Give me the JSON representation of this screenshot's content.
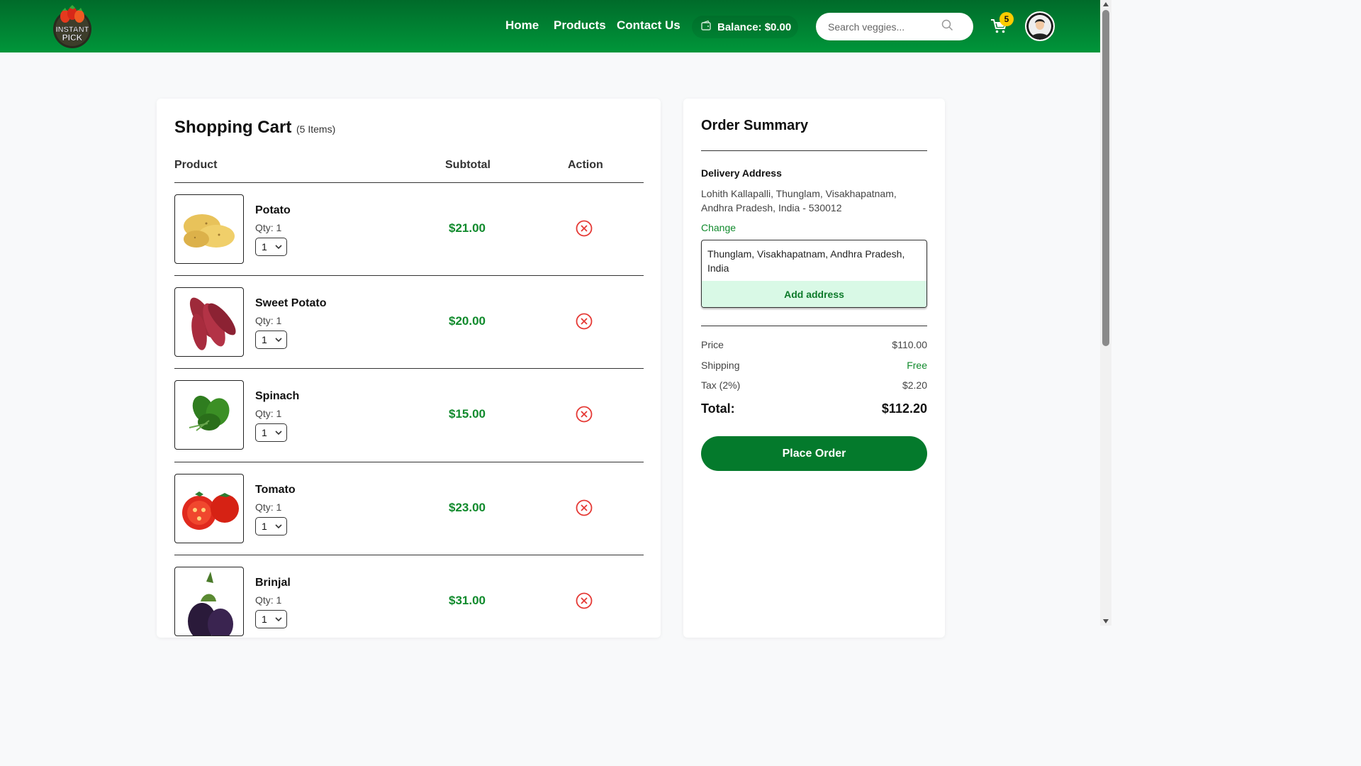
{
  "header": {
    "logo_text_line1": "INSTANT",
    "logo_text_line2": "PICK",
    "nav": {
      "home": "Home",
      "products": "Products",
      "contact": "Contact Us"
    },
    "balance_label": "Balance: $0.00",
    "search_placeholder": "Search veggies...",
    "cart_badge": "5"
  },
  "cart": {
    "title": "Shopping Cart",
    "count": "(5 Items)",
    "columns": {
      "product": "Product",
      "subtotal": "Subtotal",
      "action": "Action"
    },
    "items": [
      {
        "name": "Potato",
        "qty_label": "Qty: 1",
        "qty_value": "1",
        "subtotal": "$21.00",
        "icon": "potato-image"
      },
      {
        "name": "Sweet Potato",
        "qty_label": "Qty: 1",
        "qty_value": "1",
        "subtotal": "$20.00",
        "icon": "sweet-potato-image"
      },
      {
        "name": "Spinach",
        "qty_label": "Qty: 1",
        "qty_value": "1",
        "subtotal": "$15.00",
        "icon": "spinach-image"
      },
      {
        "name": "Tomato",
        "qty_label": "Qty: 1",
        "qty_value": "1",
        "subtotal": "$23.00",
        "icon": "tomato-image"
      },
      {
        "name": "Brinjal",
        "qty_label": "Qty: 1",
        "qty_value": "1",
        "subtotal": "$31.00",
        "icon": "brinjal-image"
      }
    ]
  },
  "summary": {
    "title": "Order Summary",
    "delivery_label": "Delivery Address",
    "delivery_address": "Lohith Kallapalli, Thunglam, Visakhapatnam, Andhra Pradesh, India - 530012",
    "change_label": "Change",
    "address_option": "Thunglam, Visakhapatnam, Andhra Pradesh, India",
    "add_address_label": "Add address",
    "price_label": "Price",
    "price_value": "$110.00",
    "shipping_label": "Shipping",
    "shipping_value": "Free",
    "tax_label": "Tax (2%)",
    "tax_value": "$2.20",
    "total_label": "Total:",
    "total_value": "$112.20",
    "place_order_label": "Place Order"
  },
  "colors": {
    "brand_green": "#047a2c",
    "header_green": "#00963a",
    "price_green": "#108a2c",
    "remove_red": "#e53935",
    "badge_yellow": "#ffcc00"
  }
}
